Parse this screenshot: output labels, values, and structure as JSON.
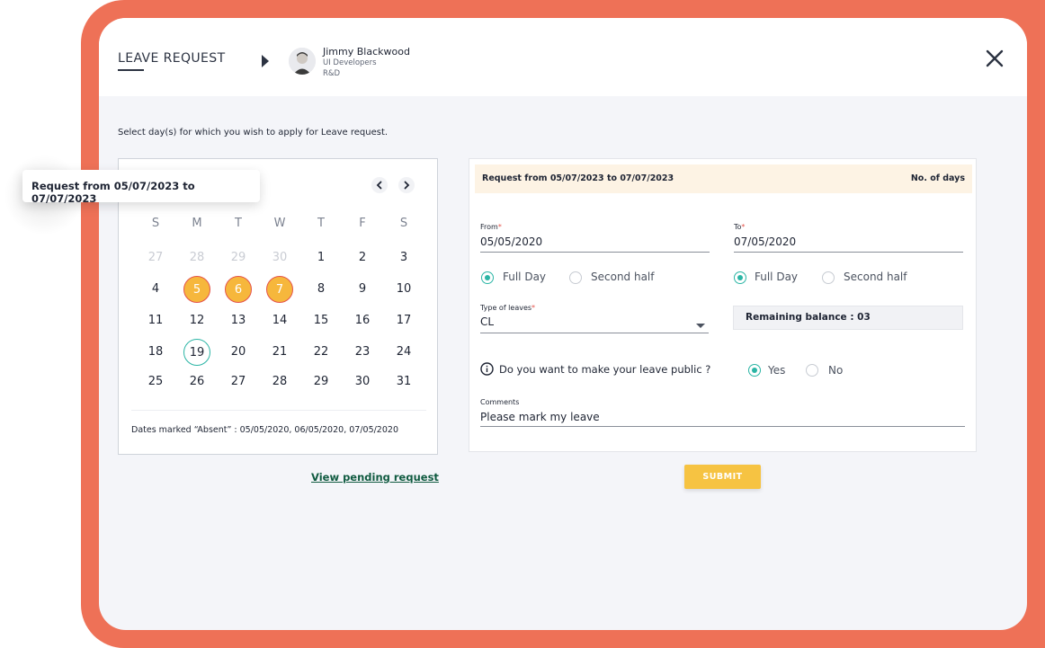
{
  "header": {
    "title": "LEAVE REQUEST",
    "user": {
      "name": "Jimmy Blackwood",
      "department": "UI Developers",
      "division": "R&D"
    },
    "close_icon": "close-icon"
  },
  "instruction": "Select day(s) for which you wish to apply for Leave request.",
  "tooltip": {
    "text": "Request from 05/07/2023 to 07/07/2023"
  },
  "calendar": {
    "weekdays": [
      "S",
      "M",
      "T",
      "W",
      "T",
      "F",
      "S"
    ],
    "weeks": [
      [
        "27",
        "28",
        "29",
        "30",
        "1",
        "2",
        "3"
      ],
      [
        "4",
        "5",
        "6",
        "7",
        "8",
        "9",
        "10"
      ],
      [
        "11",
        "12",
        "13",
        "14",
        "15",
        "16",
        "17"
      ],
      [
        "18",
        "19",
        "20",
        "21",
        "22",
        "23",
        "24"
      ],
      [
        "25",
        "26",
        "27",
        "28",
        "29",
        "30",
        "31"
      ]
    ],
    "selected_days": [
      "5",
      "6",
      "7"
    ],
    "today": "19",
    "absent_note": "Dates marked “Absent” : 05/05/2020, 06/05/2020, 07/05/2020"
  },
  "links": {
    "view_pending": "View pending request"
  },
  "form": {
    "header_left": "Request from 05/07/2023 to 07/07/2023",
    "header_right": "No. of days",
    "from": {
      "label": "From",
      "value": "05/05/2020"
    },
    "to": {
      "label": "To",
      "value": "07/05/2020"
    },
    "from_options": {
      "full_day": "Full Day",
      "second_half": "Second half",
      "selected": "Full Day"
    },
    "to_options": {
      "full_day": "Full Day",
      "second_half": "Second half",
      "selected": "Full Day"
    },
    "leave_type": {
      "label": "Type of leaves",
      "value": "CL"
    },
    "remaining_balance": "Remaining balance : 03",
    "public_question": "Do you want to make your leave public ?",
    "public_options": {
      "yes": "Yes",
      "no": "No",
      "selected": "Yes"
    },
    "comments": {
      "label": "Comments",
      "value": "Please mark my leave"
    },
    "required_mark": "*"
  },
  "submit_label": "SUBMIT",
  "colors": {
    "accent": "#2bb5a5",
    "selected_day": "#f6b73c",
    "border_frame": "#ee7157",
    "submit": "#f6c342"
  }
}
